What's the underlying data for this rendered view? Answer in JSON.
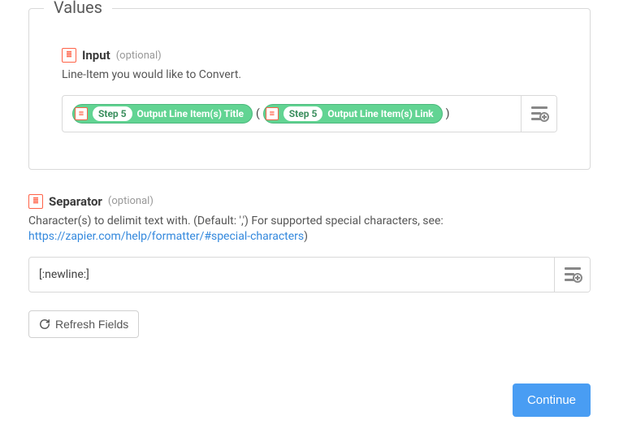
{
  "fieldset_title": "Values",
  "input": {
    "icon_name": "step-icon",
    "label": "Input",
    "optional": "(optional)",
    "help": "Line-Item you would like to Convert.",
    "pills": [
      {
        "step": "Step 5",
        "value": "Output Line Item(s) Title"
      },
      {
        "step": "Step 5",
        "value": "Output Line Item(s) Link"
      }
    ],
    "open_paren": "(",
    "close_paren": ")"
  },
  "separator": {
    "icon_name": "step-icon",
    "label": "Separator",
    "optional": "(optional)",
    "help_prefix": "Character(s) to delimit text with. (Default: ',') For supported special characters, see: ",
    "help_link_text": "https://zapier.com/help/formatter/#special-characters",
    "help_link_href": "https://zapier.com/help/formatter/#special-characters",
    "help_suffix": ")",
    "value": "[:newline:]"
  },
  "buttons": {
    "refresh": "Refresh Fields",
    "continue": "Continue"
  }
}
